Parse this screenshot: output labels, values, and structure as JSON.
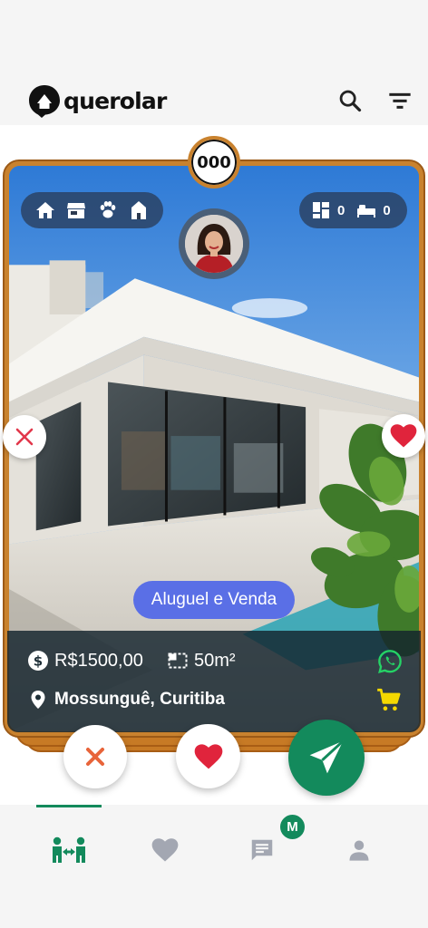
{
  "header": {
    "brand": "querolar",
    "search_icon": "search-icon",
    "filter_icon": "filter-icon"
  },
  "card": {
    "counter": "000",
    "property_types": [
      "house-icon",
      "store-icon",
      "pet-icon",
      "building-icon"
    ],
    "rooms": {
      "area_rooms": "0",
      "bedrooms": "0"
    },
    "deal_tag": "Aluguel e Venda",
    "price": "R$1500,00",
    "area": "50m²",
    "location": "Mossunguê, Curitiba",
    "photo_alt": "Modern white house with glass walls and pool"
  },
  "actions": {
    "dislike": "close-icon",
    "like": "heart-icon",
    "send": "send-icon"
  },
  "tabs": [
    {
      "id": "match",
      "icon": "match-icon",
      "active": true
    },
    {
      "id": "favorites",
      "icon": "heart-icon",
      "active": false
    },
    {
      "id": "messages",
      "icon": "chat-icon",
      "active": false
    },
    {
      "id": "profile",
      "icon": "person-icon",
      "active": false
    }
  ],
  "messages_badge": "M",
  "colors": {
    "accent": "#138a5c",
    "card_border": "#c9822e",
    "tag": "#5a6fe6",
    "dislike": "#e8643a",
    "like": "#e0243c",
    "whatsapp": "#25d366",
    "cart": "#f5d800"
  }
}
